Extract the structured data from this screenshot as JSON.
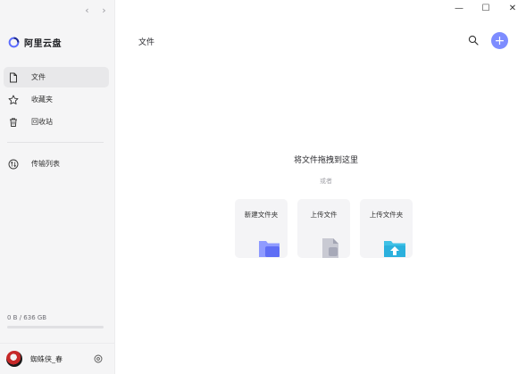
{
  "app": {
    "name": "阿里云盘"
  },
  "sidebar": {
    "nav": {
      "back": "‹",
      "forward": "›"
    },
    "items": [
      {
        "label": "文件",
        "icon": "file-icon",
        "active": true
      },
      {
        "label": "收藏夹",
        "icon": "star-icon",
        "active": false
      },
      {
        "label": "回收站",
        "icon": "trash-icon",
        "active": false
      }
    ],
    "transfer": {
      "label": "传输列表",
      "icon": "transfer-icon"
    },
    "storage": {
      "text": "0 B / 636 GB",
      "used_fraction": 0
    },
    "user": {
      "name": "蜘蛛侠_春"
    }
  },
  "window": {
    "minimize": "—",
    "maximize": "☐",
    "close": "✕"
  },
  "header": {
    "title": "文件",
    "add_label": "+"
  },
  "dropzone": {
    "title": "将文件拖拽到这里",
    "or": "或者",
    "cards": [
      {
        "label": "新建文件夹",
        "icon": "new-folder-icon"
      },
      {
        "label": "上传文件",
        "icon": "upload-file-icon"
      },
      {
        "label": "上传文件夹",
        "icon": "upload-folder-icon"
      }
    ]
  },
  "colors": {
    "accent": "#7d8cff",
    "sidebar_bg": "#f5f5f6",
    "active_bg": "#e8e8ea"
  }
}
